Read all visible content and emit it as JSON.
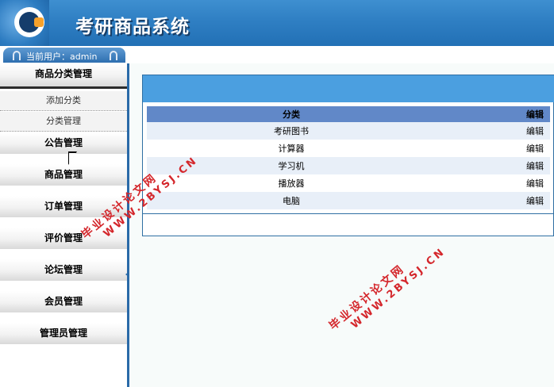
{
  "header": {
    "title": "考研商品系统"
  },
  "userbar": {
    "text": "当前用户：admin"
  },
  "sidebar": {
    "active_menu": "商品分类管理",
    "sub_items": [
      "添加分类",
      "分类管理"
    ],
    "menus": [
      "公告管理",
      "商品管理",
      "订单管理",
      "评价管理",
      "论坛管理",
      "会员管理",
      "管理员管理"
    ]
  },
  "table": {
    "headers": {
      "name": "分类",
      "action": "编辑"
    },
    "rows": [
      {
        "name": "考研图书",
        "action": "编辑"
      },
      {
        "name": "计算器",
        "action": "编辑"
      },
      {
        "name": "学习机",
        "action": "编辑"
      },
      {
        "name": "播放器",
        "action": "编辑"
      },
      {
        "name": "电脑",
        "action": "编辑"
      }
    ]
  },
  "watermark": {
    "line1": "毕业设计论文网",
    "line2": "WWW.2BYSJ.CN",
    "color": "#d4262b"
  },
  "colors": {
    "header": "#2f7fc3",
    "panel_bar": "#4b9fe0",
    "table_header": "#6188c8"
  }
}
